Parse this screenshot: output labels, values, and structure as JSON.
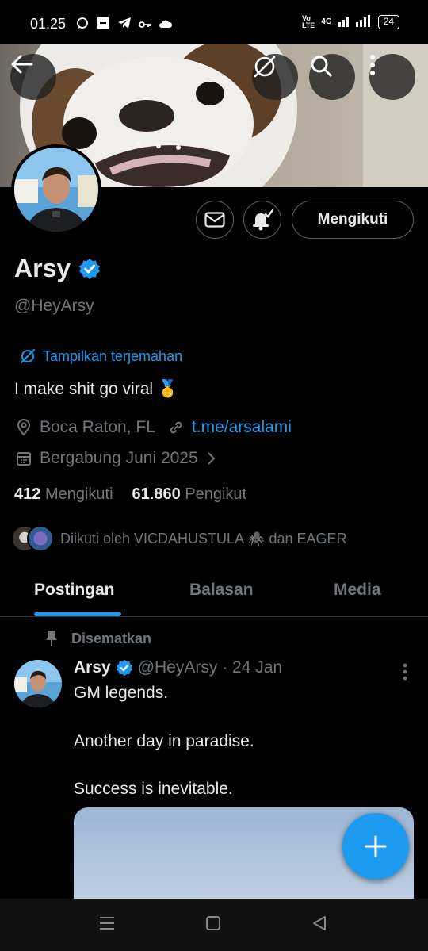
{
  "status_bar": {
    "time": "01.25",
    "network": "4G",
    "battery": "24"
  },
  "profile": {
    "name": "Arsy",
    "handle": "@HeyArsy",
    "translate_label": "Tampilkan terjemahan",
    "bio": "I make shit go viral 🥇",
    "location": "Boca Raton, FL",
    "link": "t.me/arsalami",
    "joined": "Bergabung Juni 2025",
    "following_count": "412",
    "following_label": "Mengikuti",
    "followers_count": "61.860",
    "followers_label": "Pengikut",
    "followed_by": "Diikuti oleh VICDAHUSTULA 🕷️ dan EAGER",
    "follow_button": "Mengikuti"
  },
  "tabs": [
    {
      "label": "Postingan",
      "active": true
    },
    {
      "label": "Balasan",
      "active": false
    },
    {
      "label": "Media",
      "active": false
    }
  ],
  "post": {
    "pinned_label": "Disematkan",
    "author": "Arsy",
    "meta": "@HeyArsy · 24 Jan",
    "lines": [
      "GM legends.",
      "Another day in paradise.",
      "Success is inevitable."
    ]
  },
  "colors": {
    "accent": "#1d9bf0",
    "muted": "#71767b",
    "text": "#e7e9ea"
  }
}
